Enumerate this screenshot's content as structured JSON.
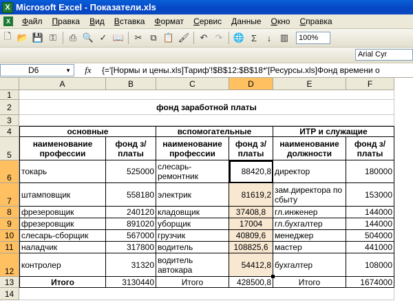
{
  "window": {
    "title": "Microsoft Excel - Показатели.xls"
  },
  "menu": [
    "Файл",
    "Правка",
    "Вид",
    "Вставка",
    "Формат",
    "Сервис",
    "Данные",
    "Окно",
    "Справка"
  ],
  "toolbar": {
    "zoom": "100%",
    "font": "Arial Cyr"
  },
  "formula_bar": {
    "name_box": "D6",
    "fx": "fx",
    "formula": "{='[Нормы и цены.xls]Тариф'!$B$12:$B$18*'[Ресурсы.xls]Фонд времени о"
  },
  "columns": [
    "A",
    "B",
    "C",
    "D",
    "E",
    "F"
  ],
  "rows": [
    "1",
    "2",
    "3",
    "4",
    "5",
    "6",
    "7",
    "8",
    "9",
    "10",
    "11",
    "12",
    "13",
    "14"
  ],
  "sheet": {
    "title": "фонд заработной платы",
    "groups": {
      "main": "основные",
      "aux": "вспомогательные",
      "itr": "ИТР и служащие"
    },
    "headers": {
      "a": "наименование профессии",
      "b": "фонд з/платы",
      "c": "наименование профессии",
      "d": "фонд з/платы",
      "e": "наименование должности",
      "f": "фонд з/платы"
    },
    "data": [
      [
        "токарь",
        "525000",
        "слесарь-ремонтник",
        "88420,8",
        "директор",
        "180000"
      ],
      [
        "штамповщик",
        "558180",
        "электрик",
        "81619,2",
        "зам.директора по сбыту",
        "153000"
      ],
      [
        "фрезеровщик",
        "240120",
        "кладовщик",
        "37408,8",
        "гл.инженер",
        "144000"
      ],
      [
        "фрезеровщик",
        "891020",
        "уборщик",
        "17004",
        "гл.бухгалтер",
        "144000"
      ],
      [
        "слесарь-сборщик",
        "567000",
        "грузчик",
        "40809,6",
        "менеджер",
        "504000"
      ],
      [
        "наладчик",
        "317800",
        "водитель",
        "108825,6",
        "мастер",
        "441000"
      ],
      [
        "контролер",
        "31320",
        "водитель автокара",
        "54412,8",
        "бухгалтер",
        "108000"
      ]
    ],
    "totals": [
      "Итого",
      "3130440",
      "Итого",
      "428500,8",
      "Итого",
      "1674000"
    ]
  }
}
